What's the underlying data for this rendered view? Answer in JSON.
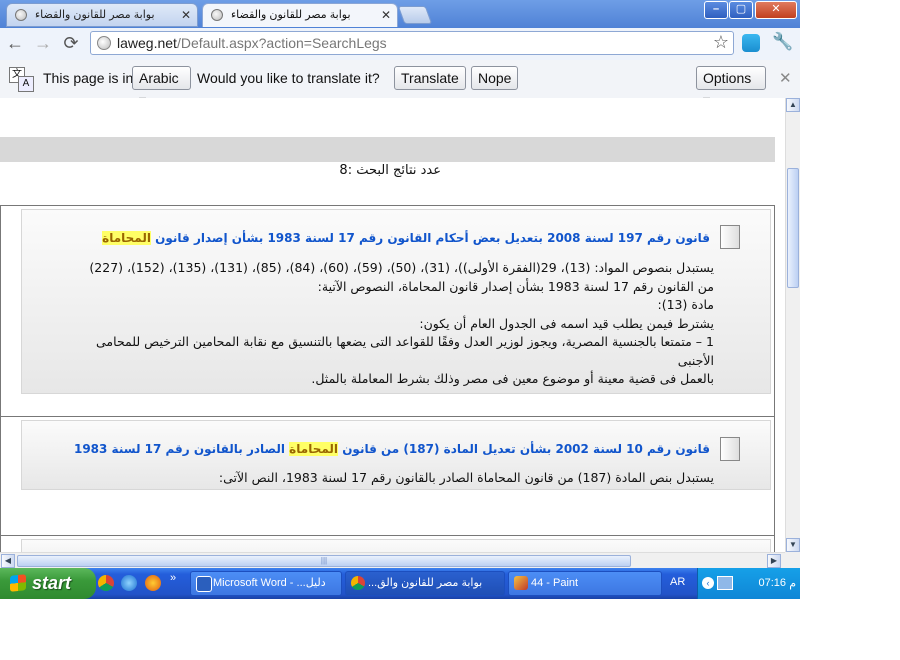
{
  "tabs": [
    {
      "title": "بوابة مصر للقانون والقضاء",
      "active": false
    },
    {
      "title": "بوابة مصر للقانون والقضاء",
      "active": true
    }
  ],
  "window_buttons": {
    "minimize": "–",
    "maximize": "▢",
    "close": "✕"
  },
  "toolbar": {
    "back": "←",
    "forward": "→",
    "reload": "⟳",
    "url_host": "laweg.net",
    "url_path": "/Default.aspx?action=SearchLegs",
    "star": "☆"
  },
  "translate_bar": {
    "prefix": "This page is in",
    "language": "Arabic ▾",
    "question": "Would you like to translate it?",
    "translate": "Translate",
    "nope": "Nope",
    "options": "Options ▾",
    "close": "✕"
  },
  "search": {
    "count_label": "عدد نتائج البحث :",
    "count": "8"
  },
  "results": [
    {
      "title_before": "قانون رقم 197 لسنة 2008 بتعديل بعض أحكام القانون رقم 17 لسنة 1983 بشأن إصدار قانون ",
      "title_highlight": "المحاماة",
      "body": [
        "يستبدل بنصوص المواد: (13)، 29(الفقرة الأولى))، (31)، (50)، (59)، (60)، (84)، (85)، (131)، (135)، (152)، (227)",
        "من القانون رقم 17 لسنة 1983 بشأن إصدار قانون المحاماة، النصوص الآتية:",
        "مادة (13):",
        "يشترط فيمن يطلب قيد اسمه فى الجدول العام أن يكون:",
        "1 – متمتعا بالجنسية المصرية، ويجوز لوزير العدل وفقًا للقواعد التى يضعها بالتنسيق مع نقابة المحامين الترخيص للمحامى الأجنبى",
        "بالعمل فى قضية معينة أو موضوع معين فى مصر وذلك بشرط المعاملة بالمثل."
      ]
    },
    {
      "title_before": "قانون رقم 10 لسنة 2002 بشأن تعديل المادة (187) من قانون ",
      "title_highlight": "المحاماة",
      "title_after": " الصادر بالقانون رقم 17 لسنة 1983",
      "body": [
        "يستبدل بنص المادة (187) من قانون المحاماة الصادر بالقانون رقم 17 لسنة 1983، النص الآتى:"
      ]
    }
  ],
  "taskbar": {
    "start": "start",
    "tasks": [
      {
        "label": "Microsoft Word - ...دليل"
      },
      {
        "label": "...بوابة مصر للقانون والق"
      },
      {
        "label": "44 - Paint"
      }
    ],
    "lang": "AR",
    "clock": "07:16",
    "ampm": "م"
  },
  "colors": {
    "link": "#1155cc",
    "highlight": "#ffff66",
    "taskbar": "#245edb",
    "start": "#3a9a3a"
  }
}
